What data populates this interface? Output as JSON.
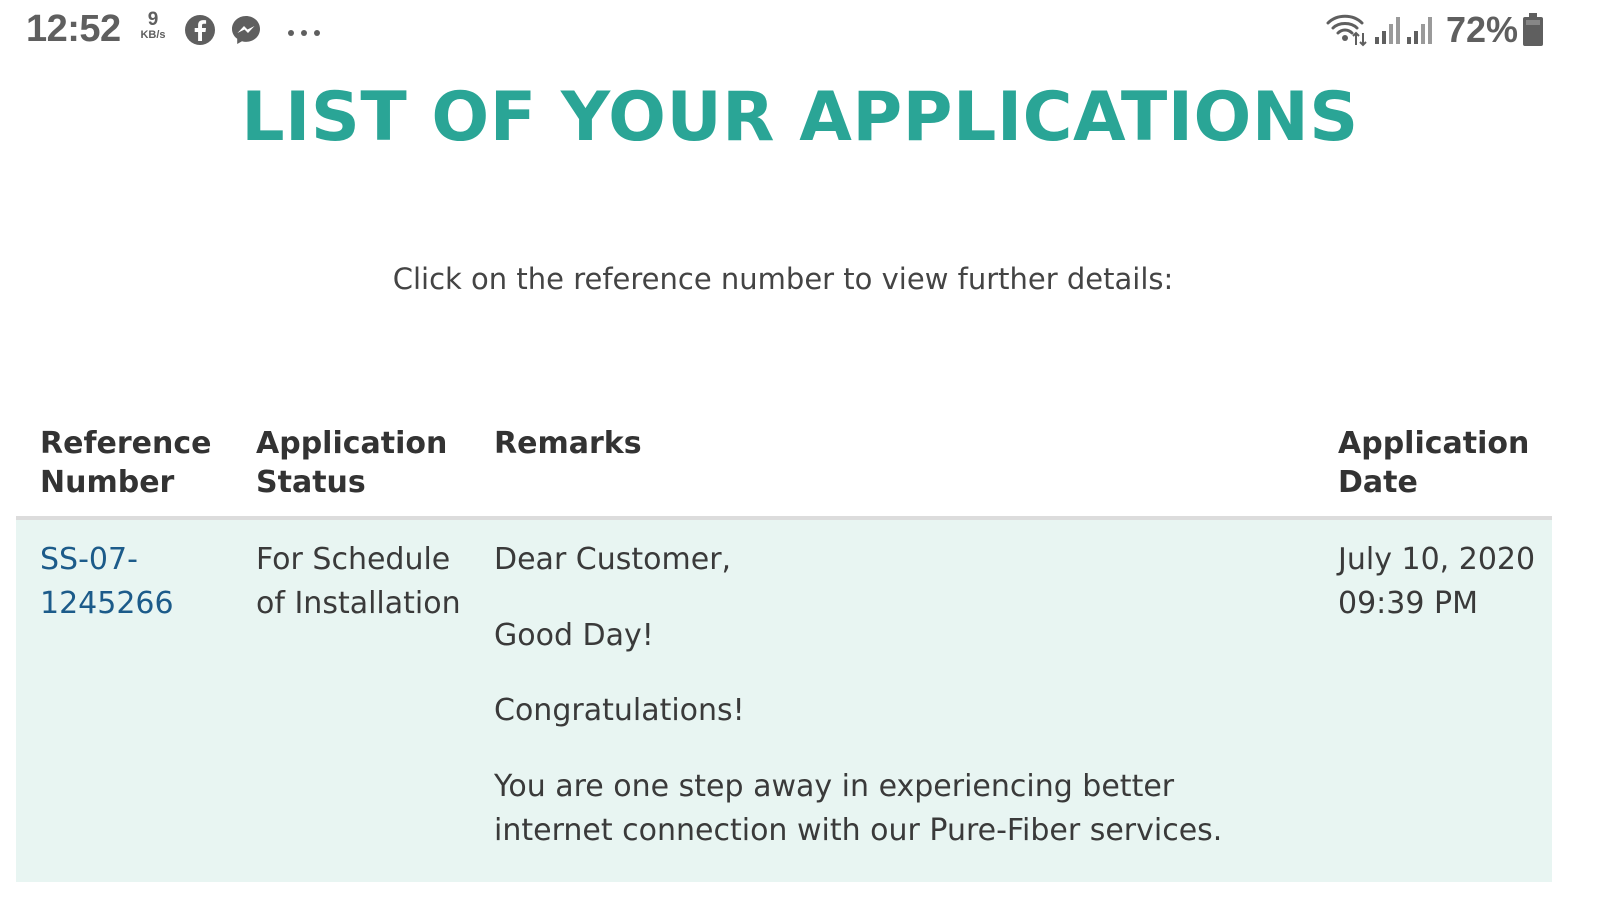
{
  "status_bar": {
    "time": "12:52",
    "net_speed_value": "9",
    "net_speed_unit": "KB/s",
    "notification_icons": [
      "facebook-icon",
      "messenger-icon",
      "more-dots-icon"
    ],
    "right_icons": [
      "wifi-icon",
      "signal-icon",
      "signal-icon",
      "battery-icon"
    ],
    "battery_percent": "72%"
  },
  "page": {
    "title": "LIST OF YOUR APPLICATIONS",
    "instruction": "Click on the reference number to view further details:",
    "accent_color": "#2aa596",
    "row_highlight_color": "#e8f5f2",
    "link_color": "#1c5b8a"
  },
  "table": {
    "headers": {
      "reference_number": "Reference Number",
      "application_status": "Application Status",
      "remarks": "Remarks",
      "application_date": "Application Date"
    },
    "rows": [
      {
        "reference_number": "SS-07-1245266",
        "application_status": "For Schedule of Installation",
        "remarks": [
          "Dear Customer,",
          "Good Day!",
          "Congratulations!",
          "You are one step away in experiencing better internet connection with our Pure-Fiber services."
        ],
        "application_date": "July 10, 2020 09:39 PM"
      }
    ]
  }
}
